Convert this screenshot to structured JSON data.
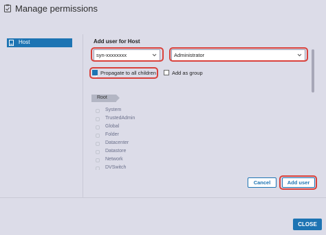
{
  "dialog": {
    "title": "Manage permissions"
  },
  "sidebar": {
    "items": [
      {
        "label": "Host",
        "icon": "host-icon",
        "selected": true
      }
    ]
  },
  "main": {
    "section_title": "Add user for Host",
    "user_field": {
      "value": "syn-xxxxxxxx",
      "icon": "chevron-down-icon"
    },
    "role_select": {
      "value": "Administrator",
      "icon": "chevron-down-icon"
    },
    "propagate": {
      "label": "Propagate to all children",
      "checked": true
    },
    "add_as_group": {
      "label": "Add as group",
      "checked": false
    },
    "root_label": "Root",
    "privileges": [
      "System",
      "TrustedAdmin",
      "Global",
      "Folder",
      "Datacenter",
      "Datastore",
      "Network",
      "DVSwitch"
    ]
  },
  "buttons": {
    "cancel": "Cancel",
    "add_user": "Add user",
    "close": "CLOSE"
  },
  "colors": {
    "accent": "#1d74b3",
    "highlight": "#d9403a",
    "background": "#dcdce8"
  }
}
